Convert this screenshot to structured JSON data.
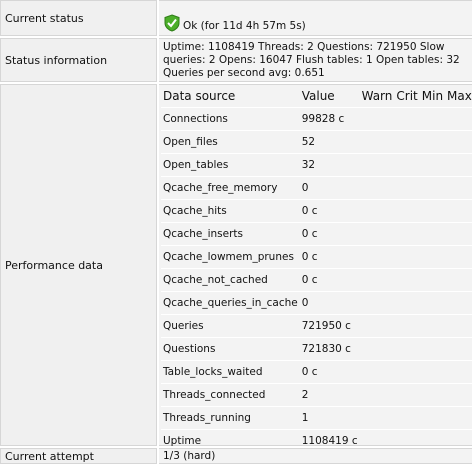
{
  "rows": {
    "current_status": {
      "label": "Current status",
      "value": "Ok (for 11d 4h 57m 5s)",
      "icon": "ok-check-shield-icon"
    },
    "status_information": {
      "label": "Status information",
      "value": "Uptime: 1108419 Threads: 2 Questions: 721950 Slow queries: 2 Opens: 16047 Flush tables: 1 Open tables: 32 Queries per second avg: 0.651"
    },
    "performance_data": {
      "label": "Performance data"
    },
    "current_attempt": {
      "label": "Current attempt",
      "value": "1/3 (hard)"
    }
  },
  "perf_table": {
    "headers": [
      "Data source",
      "Value",
      "Warn",
      "Crit",
      "Min",
      "Max"
    ],
    "rows": [
      {
        "source": "Connections",
        "value": "99828 c"
      },
      {
        "source": "Open_files",
        "value": "52"
      },
      {
        "source": "Open_tables",
        "value": "32"
      },
      {
        "source": "Qcache_free_memory",
        "value": "0"
      },
      {
        "source": "Qcache_hits",
        "value": "0 c"
      },
      {
        "source": "Qcache_inserts",
        "value": "0 c"
      },
      {
        "source": "Qcache_lowmem_prunes",
        "value": "0 c"
      },
      {
        "source": "Qcache_not_cached",
        "value": "0 c"
      },
      {
        "source": "Qcache_queries_in_cache",
        "value": "0"
      },
      {
        "source": "Queries",
        "value": "721950 c"
      },
      {
        "source": "Questions",
        "value": "721830 c"
      },
      {
        "source": "Table_locks_waited",
        "value": "0 c"
      },
      {
        "source": "Threads_connected",
        "value": "2"
      },
      {
        "source": "Threads_running",
        "value": "1"
      },
      {
        "source": "Uptime",
        "value": "1108419 c"
      }
    ]
  },
  "colors": {
    "ok_green": "#4caf2a",
    "label_bg": "#f0f0f0",
    "value_bg": "#f3f3f3"
  }
}
